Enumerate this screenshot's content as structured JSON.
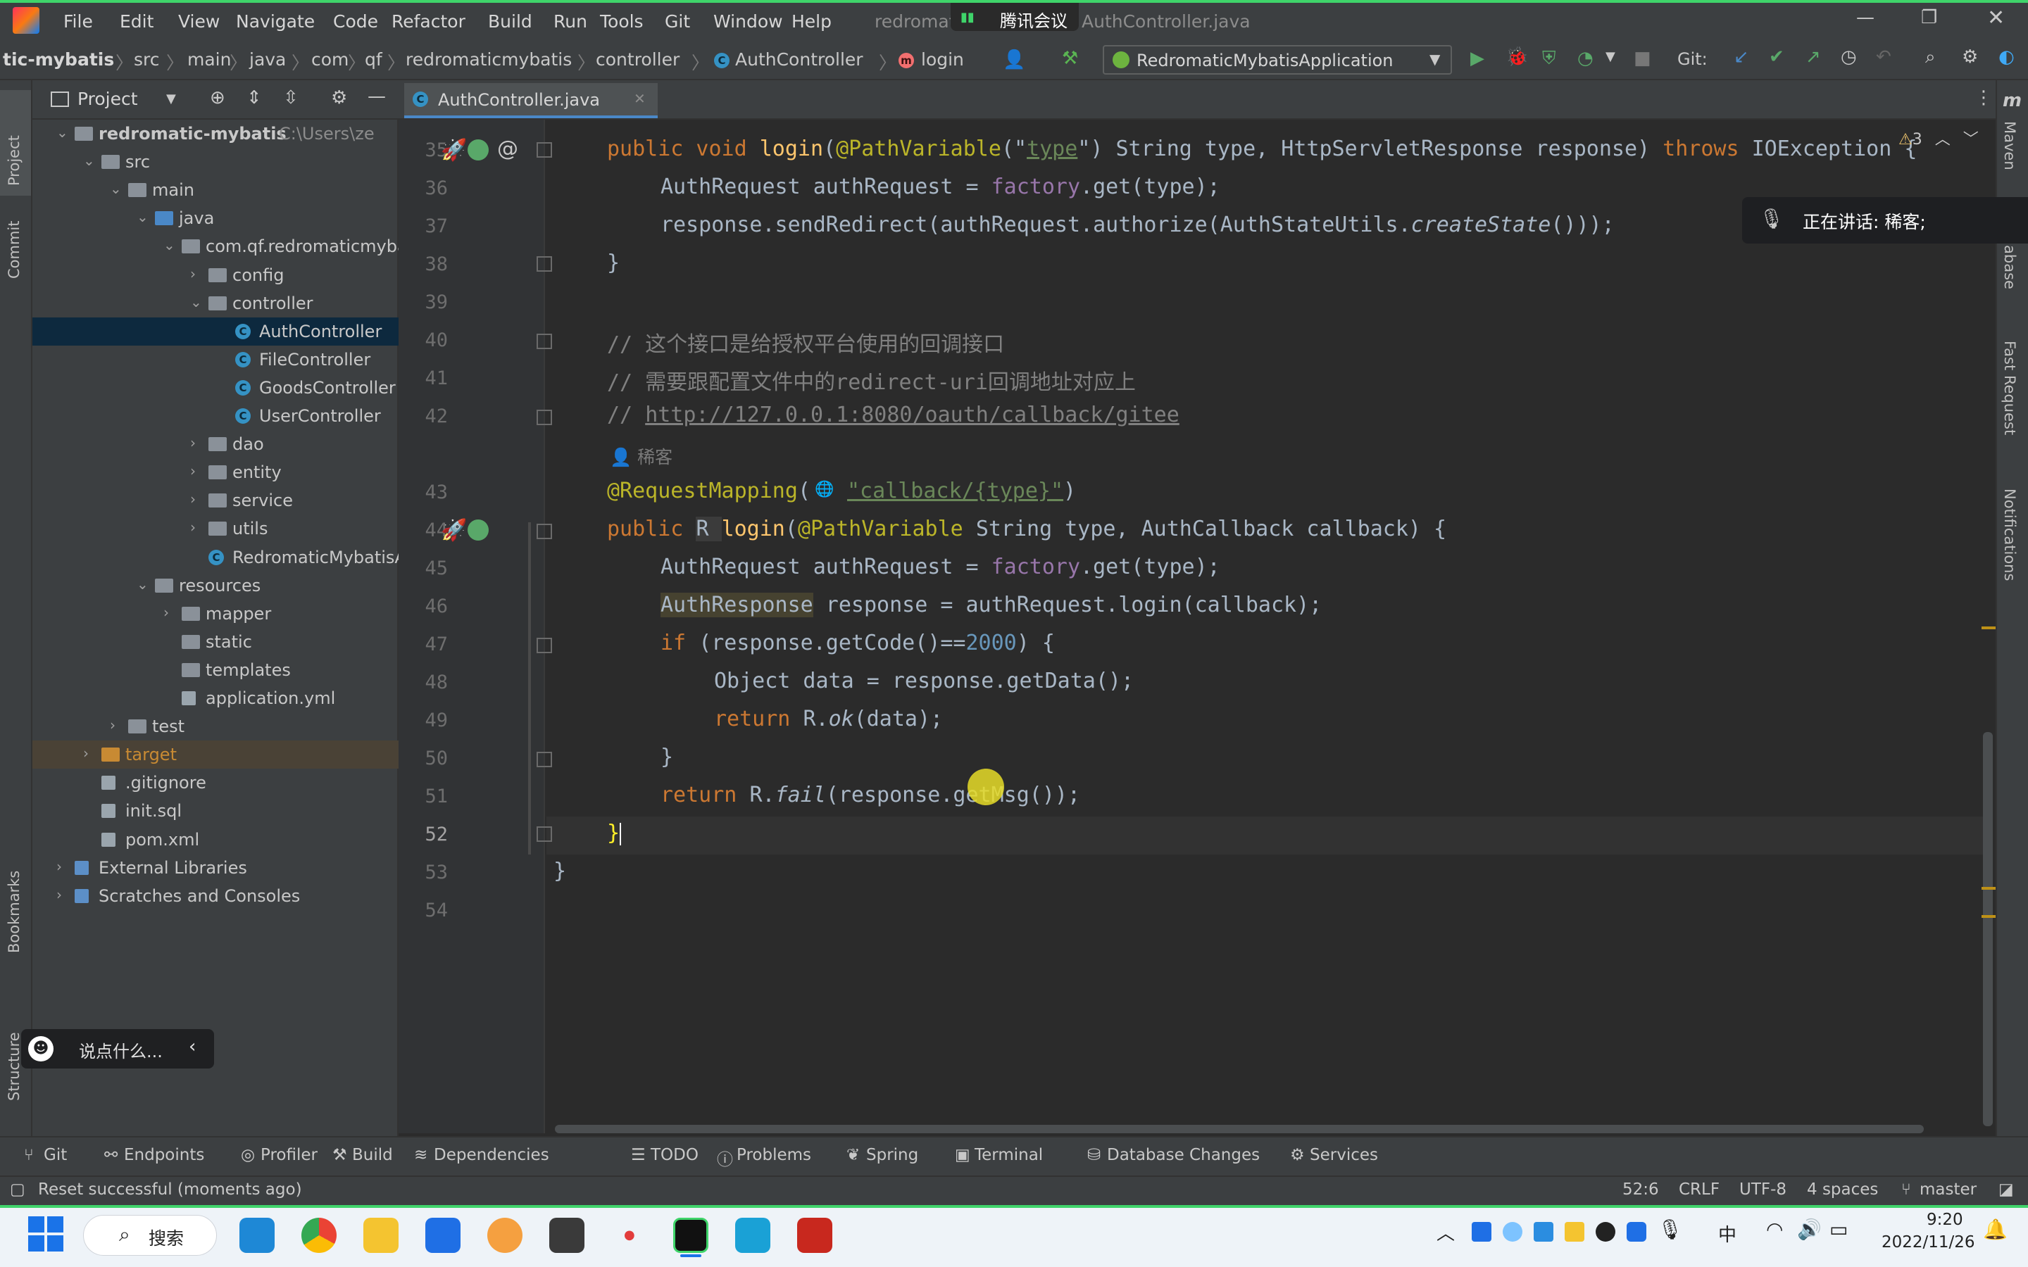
{
  "window": {
    "title": "redromaticmybatis - AuthController.java",
    "title_left": "redromat",
    "title_right": "AuthController.java",
    "meeting_badge": "腾讯会议",
    "menu": [
      "File",
      "Edit",
      "View",
      "Navigate",
      "Code",
      "Refactor",
      "Build",
      "Run",
      "Tools",
      "Git",
      "Window",
      "Help"
    ]
  },
  "breadcrumb": [
    "tic-mybatis",
    "src",
    "main",
    "java",
    "com",
    "qf",
    "redromaticmybatis",
    "controller",
    "AuthController",
    "login"
  ],
  "run_config": "RedromaticMybatisApplication",
  "git_label": "Git:",
  "project_panel": {
    "title": "Project",
    "tree": [
      {
        "label": "redromatic-mybatis",
        "hint": "C:\\Users\\ze",
        "indent": 0,
        "kind": "module",
        "bold": true
      },
      {
        "label": "src",
        "indent": 1,
        "kind": "folder"
      },
      {
        "label": "main",
        "indent": 2,
        "kind": "folder"
      },
      {
        "label": "java",
        "indent": 3,
        "kind": "folder-blue"
      },
      {
        "label": "com.qf.redromaticmyba",
        "indent": 4,
        "kind": "folder"
      },
      {
        "label": "config",
        "indent": 5,
        "kind": "folder"
      },
      {
        "label": "controller",
        "indent": 5,
        "kind": "folder"
      },
      {
        "label": "AuthController",
        "indent": 6,
        "kind": "class",
        "selected": true
      },
      {
        "label": "FileController",
        "indent": 6,
        "kind": "class"
      },
      {
        "label": "GoodsController",
        "indent": 6,
        "kind": "class"
      },
      {
        "label": "UserController",
        "indent": 6,
        "kind": "class"
      },
      {
        "label": "dao",
        "indent": 5,
        "kind": "folder"
      },
      {
        "label": "entity",
        "indent": 5,
        "kind": "folder"
      },
      {
        "label": "service",
        "indent": 5,
        "kind": "folder"
      },
      {
        "label": "utils",
        "indent": 5,
        "kind": "folder"
      },
      {
        "label": "RedromaticMybatisA",
        "indent": 5,
        "kind": "class"
      },
      {
        "label": "resources",
        "indent": 3,
        "kind": "folder"
      },
      {
        "label": "mapper",
        "indent": 4,
        "kind": "folder"
      },
      {
        "label": "static",
        "indent": 4,
        "kind": "folder"
      },
      {
        "label": "templates",
        "indent": 4,
        "kind": "folder"
      },
      {
        "label": "application.yml",
        "indent": 4,
        "kind": "file"
      },
      {
        "label": "test",
        "indent": 2,
        "kind": "folder"
      },
      {
        "label": "target",
        "indent": 1,
        "kind": "folder-orange",
        "excluded": true
      },
      {
        "label": ".gitignore",
        "indent": 1,
        "kind": "file"
      },
      {
        "label": "init.sql",
        "indent": 1,
        "kind": "file"
      },
      {
        "label": "pom.xml",
        "indent": 1,
        "kind": "file"
      },
      {
        "label": "External Libraries",
        "indent": 0,
        "kind": "lib"
      },
      {
        "label": "Scratches and Consoles",
        "indent": 0,
        "kind": "lib"
      }
    ]
  },
  "left_stripe": [
    "Project",
    "Commit",
    "Bookmarks",
    "Structure"
  ],
  "right_stripe": [
    "Maven",
    "abase",
    "Fast Request",
    "Notifications"
  ],
  "editor": {
    "tab": "AuthController.java",
    "warnings": "3",
    "author_hint": "稀客",
    "line_numbers": [
      "35",
      "36",
      "37",
      "38",
      "39",
      "40",
      "41",
      "42",
      "43",
      "44",
      "45",
      "46",
      "47",
      "48",
      "49",
      "50",
      "51",
      "52",
      "53",
      "54"
    ]
  },
  "code": {
    "l35a": "public void ",
    "l35b": "login",
    "l35c": "(",
    "l35d": "@PathVariable",
    "l35e": "(\"",
    "l35f": "type",
    "l35g": "\") String type, HttpServletResponse response) ",
    "l35h": "throws ",
    "l35i": "IOException {",
    "l36a": "AuthRequest authRequest = ",
    "l36b": "factory",
    "l36c": ".get(type);",
    "l37a": "response.sendRedirect(authRequest.authorize(AuthStateUtils.",
    "l37b": "createState",
    "l37c": "()));",
    "l38": "}",
    "l40": "// 这个接口是给授权平台使用的回调接口",
    "l41": "// 需要跟配置文件中的redirect-uri回调地址对应上",
    "l42a": "// ",
    "l42b": "http://127.0.0.1:8080/oauth/callback/gitee",
    "l43a": "@RequestMapping",
    "l43b": "(",
    "l43c": "\"callback/{type}\"",
    "l43d": ")",
    "l44a": "public ",
    "l44b": "R ",
    "l44c": "login",
    "l44d": "(",
    "l44e": "@PathVariable ",
    "l44f": "String type, AuthCallback callback) {",
    "l45a": "AuthRequest authRequest = ",
    "l45b": "factory",
    "l45c": ".get(type);",
    "l46a": "AuthResponse",
    "l46b": " response = authRequest.login(callback);",
    "l47a": "if ",
    "l47b": "(response.getCode()==",
    "l47c": "2000",
    "l47d": ") {",
    "l48": "Object data = response.getData();",
    "l49a": "return ",
    "l49b": "R.",
    "l49c": "ok",
    "l49d": "(data);",
    "l50": "}",
    "l51a": "return ",
    "l51b": "R.",
    "l51c": "fail",
    "l51d": "(response.getMsg());",
    "l52": "}",
    "l53": "}"
  },
  "speaking_overlay": "正在讲话: 稀客;",
  "chat_placeholder": "说点什么...",
  "tool_windows": [
    "Git",
    "Endpoints",
    "Profiler",
    "Build",
    "Dependencies",
    "TODO",
    "Problems",
    "Spring",
    "Terminal",
    "Database Changes",
    "Services"
  ],
  "status": {
    "message": "Reset successful (moments ago)",
    "position": "52:6",
    "line_sep": "CRLF",
    "encoding": "UTF-8",
    "indent": "4 spaces",
    "branch": "master"
  },
  "taskbar": {
    "search": "搜索",
    "ime": "中",
    "time": "9:20",
    "date": "2022/11/26"
  },
  "colors": {
    "accent": "#3fd46a",
    "keyword": "#cc7832",
    "function": "#ffc66d",
    "string": "#6a8759",
    "annotation": "#bbb529",
    "comment": "#808080",
    "number": "#6897bb",
    "selection": "#0d293e"
  }
}
